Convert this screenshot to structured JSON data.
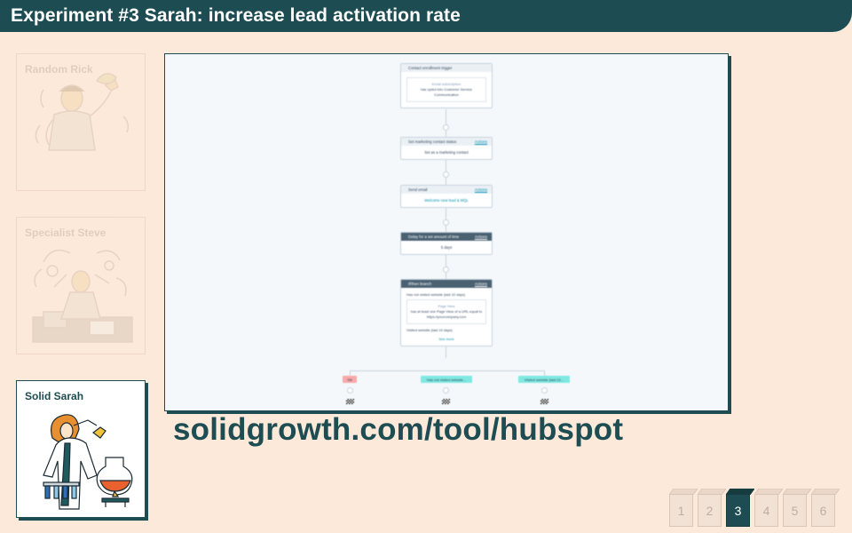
{
  "header": {
    "title": "Experiment #3 Sarah: increase lead activation rate"
  },
  "personas": [
    {
      "name": "Random Rick",
      "state": "inactive"
    },
    {
      "name": "Specialist Steve",
      "state": "inactive"
    },
    {
      "name": "Solid Sarah",
      "state": "active"
    }
  ],
  "workflow": {
    "trigger": {
      "header": "Contact enrollment trigger",
      "inner_title": "Email subscription",
      "inner_text": "has opted into Customer Service Communication"
    },
    "step1": {
      "header": "Set marketing contact status",
      "action": "Actions",
      "body": "Set as a marketing contact"
    },
    "step2": {
      "header": "Send email",
      "action": "Actions",
      "body": "Welcome new lead & MQL"
    },
    "step3": {
      "header": "Delay for a set amount of time",
      "action": "Actions",
      "body": "5 days"
    },
    "step4": {
      "header": "If/then branch",
      "action": "Actions",
      "branch1": "Has not visited website (last 10 days)",
      "inner_title": "Page View",
      "inner_text": "has at least one Page View of a URL equal to https://yourcompany.com",
      "branch2": "Visited website (last 10 days)",
      "see_more": "See more"
    },
    "branches": [
      "Stil",
      "Has not visited website...",
      "Visited website (last 10..."
    ]
  },
  "url": "solidgrowth.com/tool/hubspot",
  "pager": {
    "pages": [
      "1",
      "2",
      "3",
      "4",
      "5",
      "6"
    ],
    "current": "3"
  },
  "colors": {
    "primary": "#1d4d52",
    "background": "#fce9da",
    "link": "#0091ae",
    "branch_red": "#f8a9a9",
    "branch_teal": "#7fe8e0"
  }
}
